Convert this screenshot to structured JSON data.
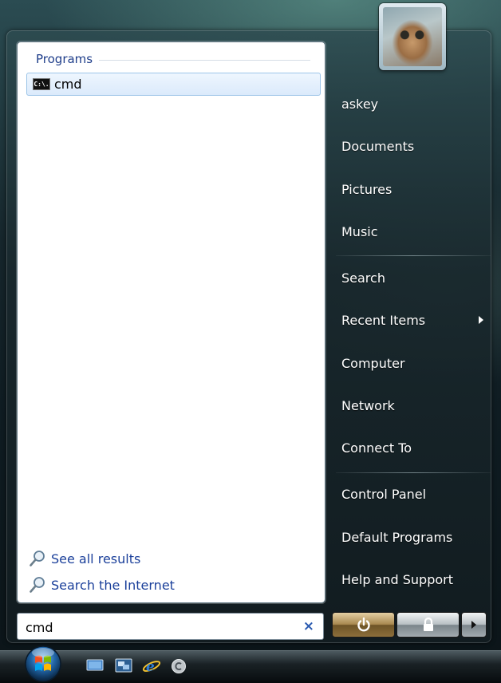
{
  "user": {
    "name": "askey",
    "avatar_alt": "user-avatar"
  },
  "programs": {
    "header": "Programs",
    "items": [
      {
        "icon": "cmd-icon",
        "label": "cmd",
        "icon_text": "C:\\."
      }
    ]
  },
  "bottom_links": {
    "see_all": "See all results",
    "search_internet": "Search the Internet"
  },
  "search": {
    "value": "cmd",
    "clear_glyph": "×"
  },
  "right_menu": {
    "documents": "Documents",
    "pictures": "Pictures",
    "music": "Music",
    "search": "Search",
    "recent_items": "Recent Items",
    "computer": "Computer",
    "network": "Network",
    "connect_to": "Connect To",
    "control_panel": "Control Panel",
    "default_programs": "Default Programs",
    "help_support": "Help and Support"
  },
  "colors": {
    "link_blue": "#1a3f9a",
    "header_blue": "#1e3d8a",
    "power_button": "#a98950",
    "lock_button": "#b9c0c4"
  }
}
